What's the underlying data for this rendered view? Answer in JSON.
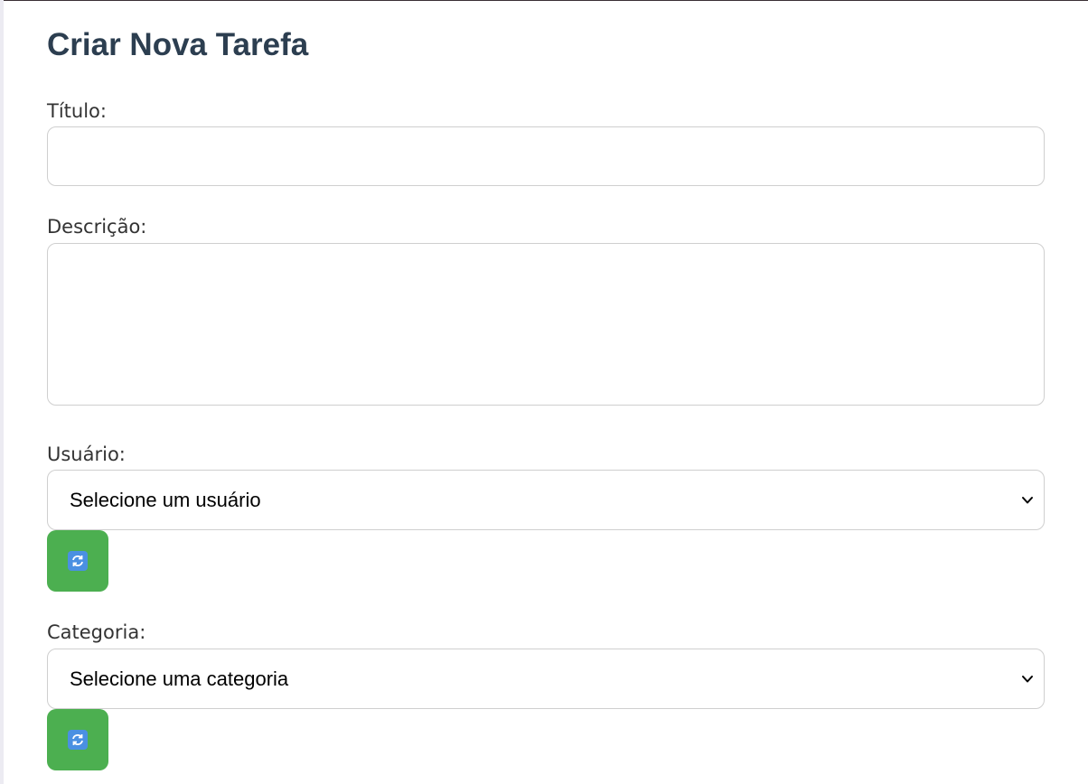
{
  "form": {
    "title": "Criar Nova Tarefa",
    "fields": {
      "titulo": {
        "label": "Título:",
        "value": "",
        "placeholder": ""
      },
      "descricao": {
        "label": "Descrição:",
        "value": "",
        "placeholder": ""
      },
      "usuario": {
        "label": "Usuário:",
        "selected": "Selecione um usuário"
      },
      "categoria": {
        "label": "Categoria:",
        "selected": "Selecione uma categoria"
      }
    },
    "buttons": {
      "refresh_icon": "refresh-icon"
    }
  },
  "colors": {
    "title": "#2c3e50",
    "label": "#333333",
    "field_border": "#cfcfcf",
    "refresh_button": "#4caf50",
    "refresh_icon_bg": "#4a90e2"
  }
}
